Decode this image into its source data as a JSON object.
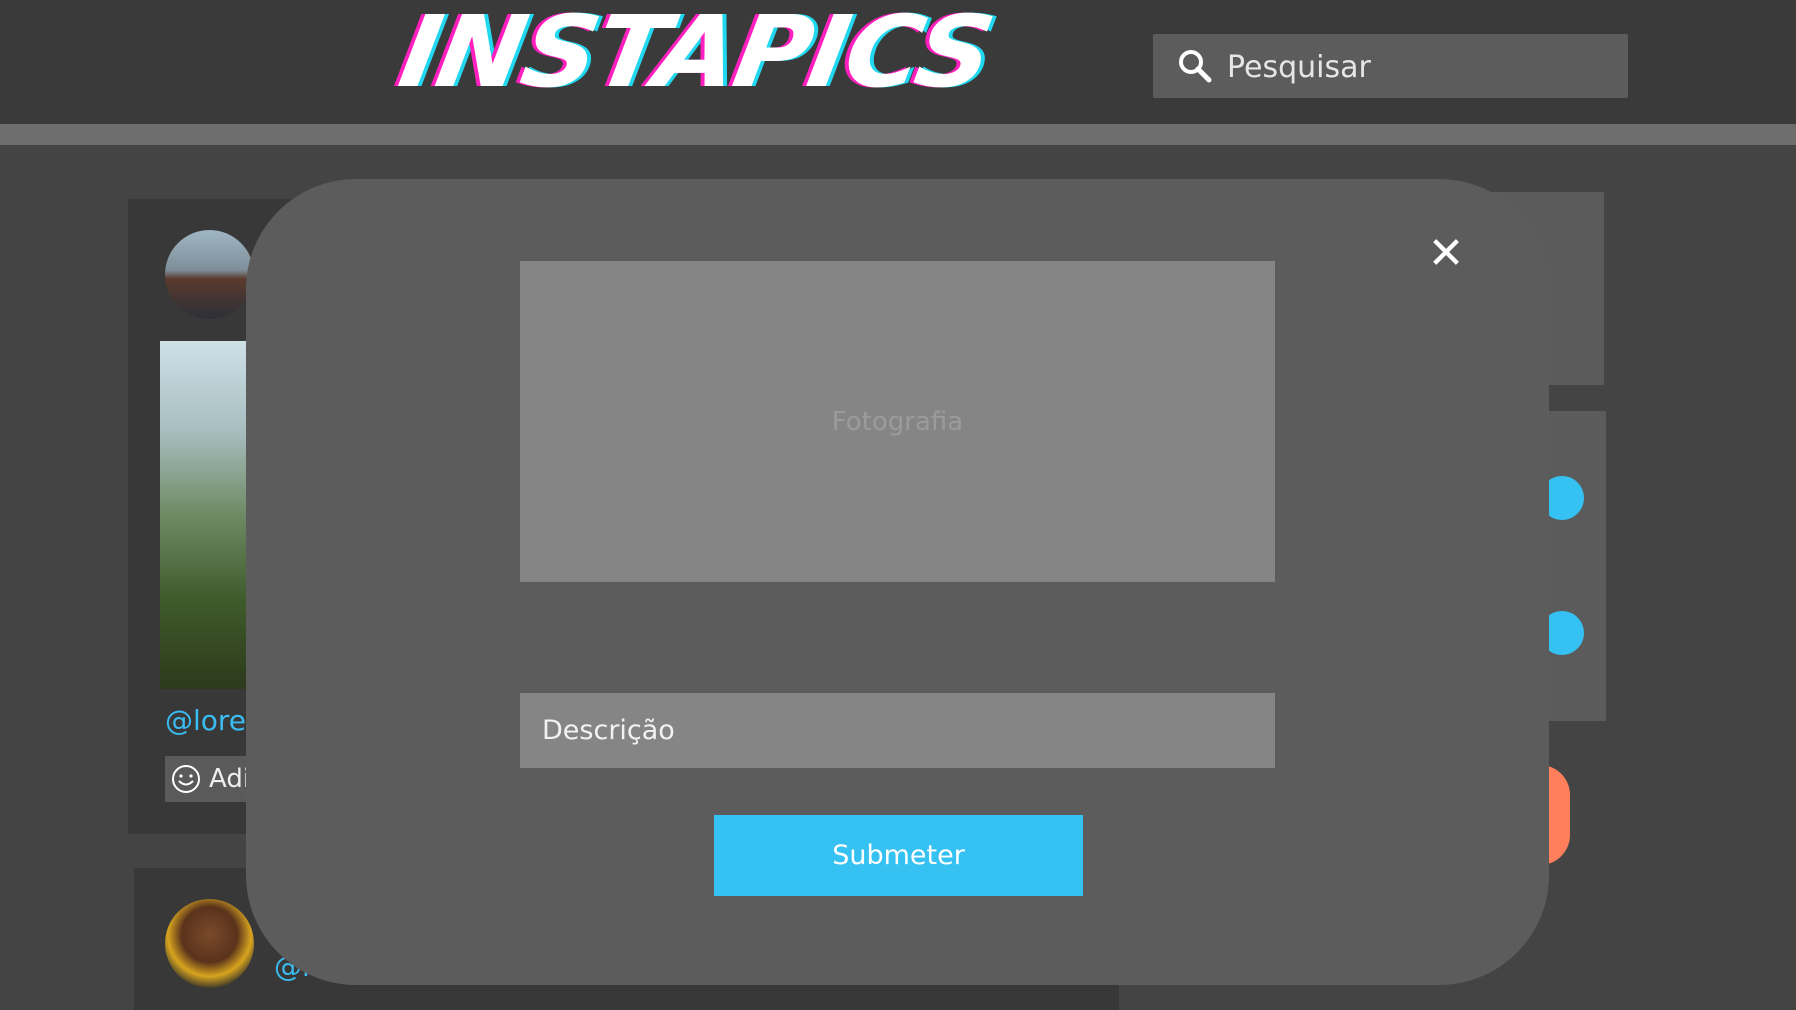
{
  "header": {
    "logo_text": "INSTAPICS",
    "search_placeholder": "Pesquisar"
  },
  "feed": {
    "post1_handle": "@lorem",
    "post1_add_label": "Adi",
    "post2_handle": "@lo"
  },
  "modal": {
    "photo_placeholder": "Fotografia",
    "description_placeholder": "Descrição",
    "submit_label": "Submeter",
    "close_symbol": "✕"
  },
  "colors": {
    "accent": "#35c1f2",
    "logo_magenta": "#ff1fbf",
    "logo_cyan": "#22d8f0",
    "orange": "#ff7f5c"
  }
}
